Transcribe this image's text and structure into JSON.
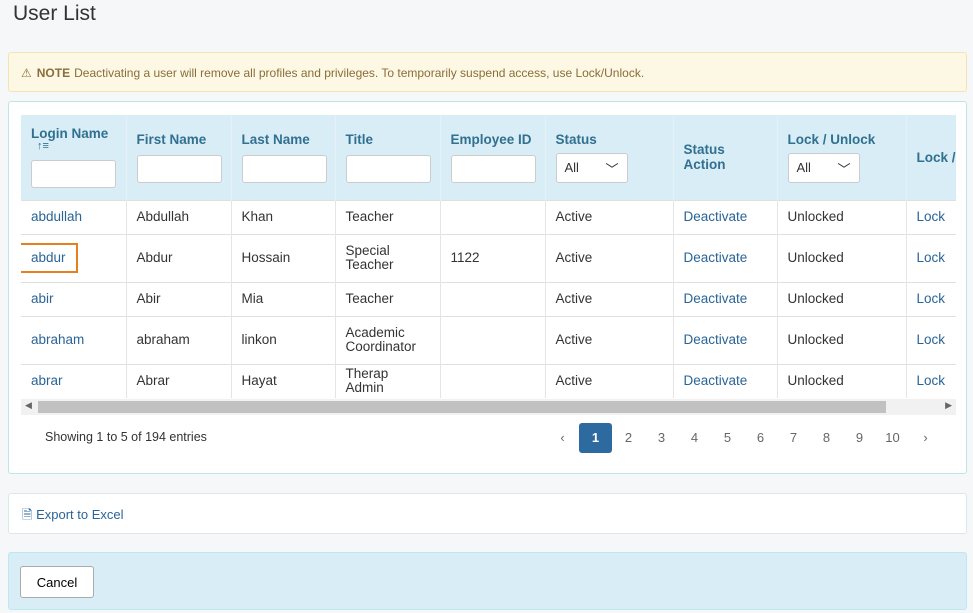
{
  "page_title": "User List",
  "note": {
    "icon": "warning-icon",
    "label": "NOTE",
    "text": "Deactivating a user will remove all profiles and privileges. To temporarily suspend access, use Lock/Unlock."
  },
  "columns": [
    "Login Name",
    "First Name",
    "Last Name",
    "Title",
    "Employee ID",
    "Status",
    "Status Action",
    "Lock / Unlock",
    "Lock / Action"
  ],
  "filters": {
    "status": "All",
    "lock": "All"
  },
  "rows": [
    {
      "login": "abdullah",
      "first": "Abdullah",
      "last": "Khan",
      "title": "Teacher",
      "emp": "",
      "status": "Active",
      "action": "Deactivate",
      "lock": "Unlocked",
      "lock_action": "Lock"
    },
    {
      "login": "abdur",
      "first": "Abdur",
      "last": "Hossain",
      "title": "Special Teacher",
      "emp": "1122",
      "status": "Active",
      "action": "Deactivate",
      "lock": "Unlocked",
      "lock_action": "Lock"
    },
    {
      "login": "abir",
      "first": "Abir",
      "last": "Mia",
      "title": "Teacher",
      "emp": "",
      "status": "Active",
      "action": "Deactivate",
      "lock": "Unlocked",
      "lock_action": "Lock"
    },
    {
      "login": "abraham",
      "first": "abraham",
      "last": "linkon",
      "title": "Academic Coordinator",
      "emp": "",
      "status": "Active",
      "action": "Deactivate",
      "lock": "Unlocked",
      "lock_action": "Lock"
    },
    {
      "login": "abrar",
      "first": "Abrar",
      "last": "Hayat",
      "title": "Therap Admin",
      "emp": "",
      "status": "Active",
      "action": "Deactivate",
      "lock": "Unlocked",
      "lock_action": "Lock"
    }
  ],
  "showing": "Showing 1 to 5 of 194 entries",
  "pages": [
    "1",
    "2",
    "3",
    "4",
    "5",
    "6",
    "7",
    "8",
    "9",
    "10"
  ],
  "current_page": "1",
  "export_label": "Export to Excel",
  "cancel_label": "Cancel",
  "colors": {
    "accent": "#2d6a9f",
    "header_bg": "#d9edf7",
    "highlight": "#e67e22"
  }
}
